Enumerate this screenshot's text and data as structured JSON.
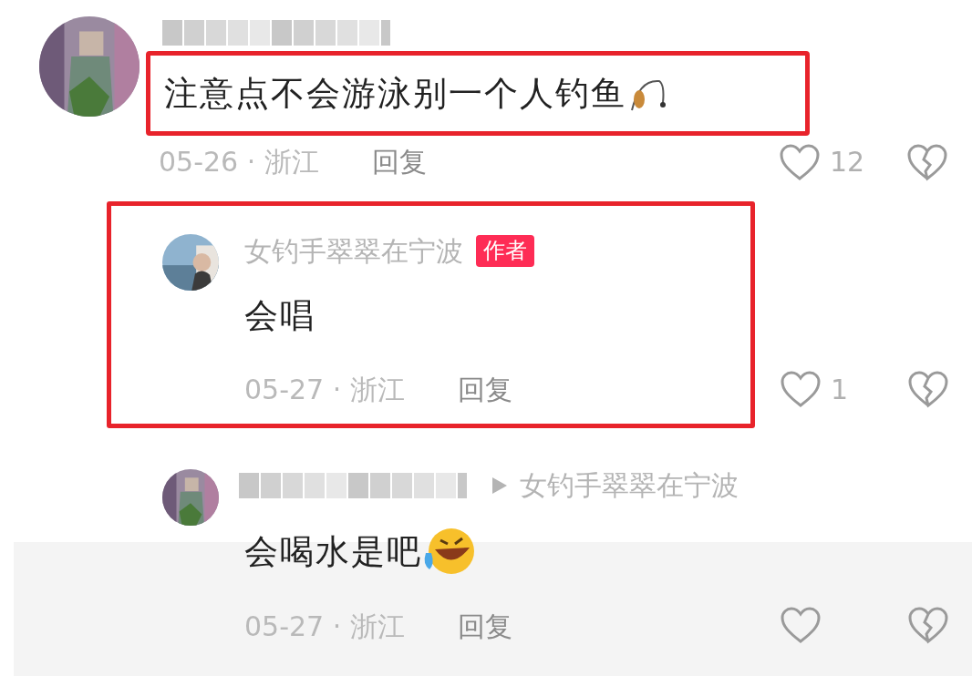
{
  "comment": {
    "text": "注意点不会游泳别一个人钓鱼",
    "text_highlighted": true,
    "meta": "05-26 · 浙江",
    "reply_label": "回复",
    "likes": "12",
    "replies": [
      {
        "kind": "author",
        "name": "女钓手翠翠在宁波",
        "badge": "作者",
        "text": "会唱",
        "meta": "05-27 · 浙江",
        "reply_label": "回复",
        "likes": "1",
        "highlighted": true
      },
      {
        "kind": "reply_to",
        "reply_to": "女钓手翠翠在宁波",
        "text": "会喝水是吧",
        "meta": "05-27 · 浙江",
        "reply_label": "回复",
        "highlighted": false
      }
    ]
  }
}
